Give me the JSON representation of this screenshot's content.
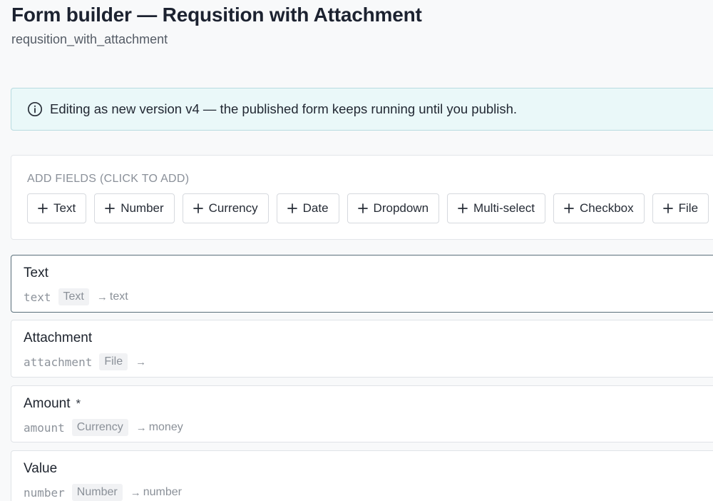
{
  "header": {
    "title": "Form builder — Requsition with Attachment",
    "slug": "requsition_with_attachment"
  },
  "banner": {
    "icon": "info-icon",
    "text": "Editing as new version v4 — the published form keeps running until you publish."
  },
  "palette": {
    "heading": "ADD FIELDS (CLICK TO ADD)",
    "buttons": [
      {
        "label": "Text",
        "icon": "plus-icon"
      },
      {
        "label": "Number",
        "icon": "plus-icon"
      },
      {
        "label": "Currency",
        "icon": "plus-icon"
      },
      {
        "label": "Date",
        "icon": "plus-icon"
      },
      {
        "label": "Dropdown",
        "icon": "plus-icon"
      },
      {
        "label": "Multi-select",
        "icon": "plus-icon"
      },
      {
        "label": "Checkbox",
        "icon": "plus-icon"
      },
      {
        "label": "File",
        "icon": "plus-icon"
      }
    ]
  },
  "fields": [
    {
      "name": "Text",
      "required": "",
      "key": "text",
      "type": "Text",
      "arrow": "→",
      "maps_to": "text",
      "selected": true
    },
    {
      "name": "Attachment",
      "required": "",
      "key": "attachment",
      "type": "File",
      "arrow": "→",
      "maps_to": "",
      "selected": false
    },
    {
      "name": "Amount",
      "required": "*",
      "key": "amount",
      "type": "Currency",
      "arrow": "→",
      "maps_to": "money",
      "selected": false
    },
    {
      "name": "Value",
      "required": "",
      "key": "number",
      "type": "Number",
      "arrow": "→",
      "maps_to": "number",
      "selected": false
    }
  ],
  "colors": {
    "banner_bg": "#eaf8f9",
    "banner_border": "#b8dbe0",
    "selected_border": "#5a6f7a",
    "page_bg": "#f8f9fa"
  }
}
